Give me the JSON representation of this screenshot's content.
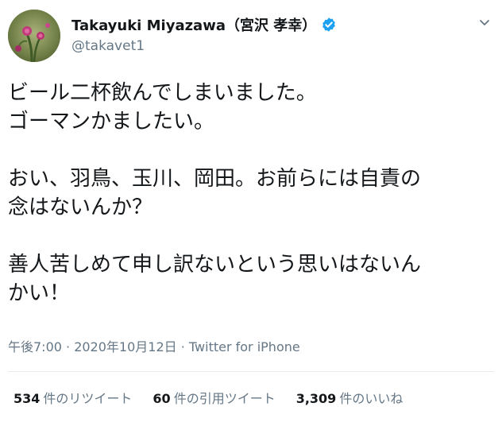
{
  "author": {
    "display_name": "Takayuki Miyazawa（宮沢 孝幸）",
    "handle": "@takavet1",
    "verified_icon": "verified-badge-icon",
    "avatar_icon": "thistle-flower-avatar"
  },
  "tweet": {
    "paragraphs": [
      "ビール二杯飲んでしまいました。\nゴーマンかましたい。",
      "おい、羽鳥、玉川、岡田。お前らには自責の\n念はないんか？",
      "善人苦しめて申し訳ないという思いはないん\nかい！"
    ]
  },
  "meta": {
    "time": "午後7:00 · 2020年10月12日",
    "separator": " · ",
    "source": "Twitter for iPhone"
  },
  "stats": {
    "retweets_count": "534",
    "retweets_label": "件のリツイート",
    "quotes_count": "60",
    "quotes_label": "件の引用ツイート",
    "likes_count": "3,309",
    "likes_label": "件のいいね"
  },
  "colors": {
    "text": "#14171a",
    "secondary": "#657786",
    "verified": "#1da1f2",
    "divider": "#e6ecf0"
  }
}
